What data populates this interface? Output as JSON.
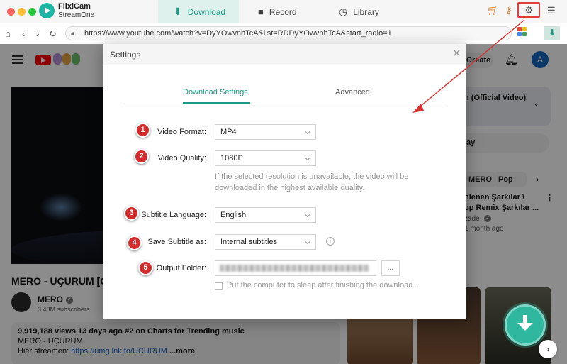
{
  "app": {
    "name": "FlixiCam",
    "sub": "StreamOne"
  },
  "tabs": [
    {
      "label": "Download"
    },
    {
      "label": "Record"
    },
    {
      "label": "Library"
    }
  ],
  "browser": {
    "url": "https://www.youtube.com/watch?v=DyYOwvnhTcA&list=RDDyYOwvnhTcA&start_radio=1"
  },
  "youtube": {
    "create": "Create",
    "avatar": "A",
    "video_title": "MERO - UÇURUM [O",
    "channel": "MERO",
    "subscribers": "3.48M subscribers",
    "desc_stats": "9,919,188 views  13 days ago",
    "desc_tag": "#2 on Charts for Trending music",
    "desc_line2": "MERO - UÇURUM",
    "desc_line3_prefix": "Hier streamen: ",
    "desc_link": "https://umg.lnk.to/UCURUM",
    "desc_more": "...more",
    "mix_title": "n (Official Video)",
    "play": "lay",
    "chips": [
      "MERO",
      "Pop Mu"
    ],
    "side_title_1": "nlenen Şarkılar \\",
    "side_title_2": "op Remix Şarkılar ...",
    "side_author": "zade",
    "side_time": "1 month ago"
  },
  "settings": {
    "title": "Settings",
    "tabs": {
      "download": "Download Settings",
      "advanced": "Advanced"
    },
    "fields": [
      {
        "num": "1",
        "label": "Video Format:",
        "value": "MP4"
      },
      {
        "num": "2",
        "label": "Video Quality:",
        "value": "1080P"
      },
      {
        "num": "3",
        "label": "Subtitle Language:",
        "value": "English"
      },
      {
        "num": "4",
        "label": "Save Subtitle as:",
        "value": "Internal subtitles"
      },
      {
        "num": "5",
        "label": "Output Folder:",
        "value": ""
      }
    ],
    "note": "If the selected resolution is unavailable, the video will be downloaded in the highest available quality.",
    "browse": "...",
    "sleep_label": "Put the computer to sleep after finishing the download..."
  },
  "colors": {
    "accent": "#1a9a84",
    "badge": "#d32b2b",
    "highlight": "#e03d3d"
  }
}
